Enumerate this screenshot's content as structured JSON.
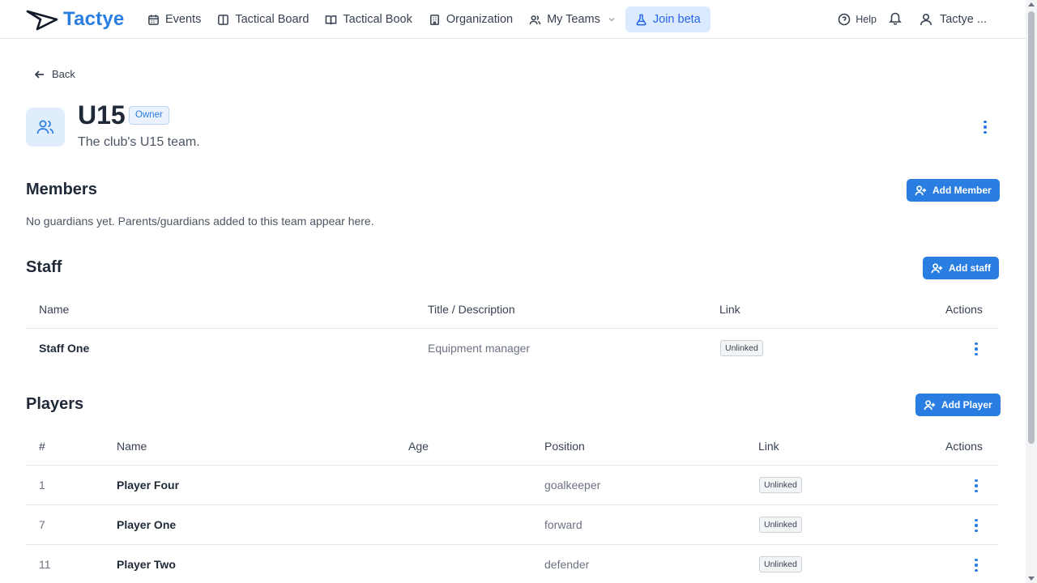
{
  "brand": {
    "name": "Tactye",
    "accent": "#2a7de1"
  },
  "nav": {
    "items": [
      {
        "label": "Events",
        "icon": "calendar-icon"
      },
      {
        "label": "Tactical Board",
        "icon": "board-icon"
      },
      {
        "label": "Tactical Book",
        "icon": "book-icon"
      },
      {
        "label": "Organization",
        "icon": "building-icon"
      },
      {
        "label": "My Teams",
        "icon": "users-icon"
      },
      {
        "label": "Join beta",
        "icon": "flask-icon"
      }
    ],
    "help_label": "Help",
    "user_label": "Tactye ..."
  },
  "back_label": "Back",
  "team": {
    "name": "U15",
    "role_badge": "Owner",
    "description": "The club's U15 team."
  },
  "members": {
    "title": "Members",
    "add_button": "Add Member",
    "empty_text": "No guardians yet. Parents/guardians added to this team appear here."
  },
  "staff": {
    "title": "Staff",
    "add_button": "Add staff",
    "columns": [
      "Name",
      "Title / Description",
      "Link",
      "Actions"
    ],
    "rows": [
      {
        "name": "Staff One",
        "title": "Equipment manager",
        "link": "Unlinked"
      }
    ]
  },
  "players": {
    "title": "Players",
    "add_button": "Add Player",
    "columns": [
      "#",
      "Name",
      "Age",
      "Position",
      "Link",
      "Actions"
    ],
    "rows": [
      {
        "number": "1",
        "name": "Player Four",
        "age": "",
        "position": "goalkeeper",
        "link": "Unlinked"
      },
      {
        "number": "7",
        "name": "Player One",
        "age": "",
        "position": "forward",
        "link": "Unlinked"
      },
      {
        "number": "11",
        "name": "Player Two",
        "age": "",
        "position": "defender",
        "link": "Unlinked"
      }
    ]
  }
}
